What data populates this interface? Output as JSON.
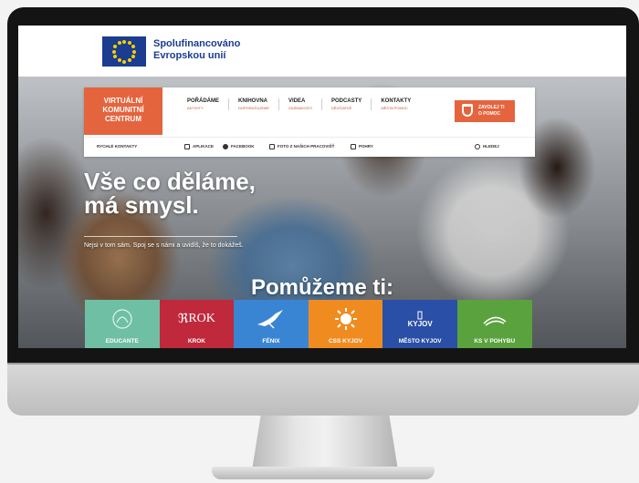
{
  "eu_banner": {
    "line1": "Spolufinancováno",
    "line2": "Evropskou unií",
    "flag_color": "#1b3c8f",
    "star_color": "#f5d000"
  },
  "nav": {
    "brand_line1": "VIRTUÁLNÍ",
    "brand_line2": "KOMUNITNÍ",
    "brand_line3": "CENTRUM",
    "brand_color": "#e4643e",
    "menu": [
      {
        "label": "POŘÁDÁME",
        "sub": "AKTIVITY"
      },
      {
        "label": "KNIHOVNA",
        "sub": "DOPORUČUJEME"
      },
      {
        "label": "VIDEA",
        "sub": "ZAJÍMAVOSTI"
      },
      {
        "label": "PODCASTY",
        "sub": "DĚVČIATKÉ"
      },
      {
        "label": "KONTAKTY",
        "sub": "MĚSTA POMOC"
      }
    ],
    "help_button_line1": "ZAVOLEJ TI",
    "help_button_line2": "O POMOC"
  },
  "subnav": {
    "quick_contact": "RYCHLÉ KONTAKTY",
    "apps": "APLIKACE",
    "facebook": "FACEBOOK",
    "photos": "FOTO Z NAŠICH PRACOVIŠŤ",
    "games": "POHRY",
    "search": "HLEDEJ"
  },
  "hero": {
    "headline_line1": "Vše co děláme,",
    "headline_line2": "má smysl.",
    "tagline": "Nejsi v tom sám. Spoj se s námi a uvidíš, že to dokážeš.",
    "helps_title": "Pomůžeme ti:"
  },
  "tiles": [
    {
      "label": "EDUCANTE",
      "color": "#6fbfa5",
      "icon": "educante-logo-icon"
    },
    {
      "label": "KROK",
      "color": "#c0283c",
      "icon": "krok-logo-icon",
      "logo_text": "ROK"
    },
    {
      "label": "FÉNIX",
      "color": "#3a85d3",
      "icon": "fenix-bird-icon"
    },
    {
      "label": "CSS KYJOV",
      "color": "#f08c1f",
      "icon": "sun-icon"
    },
    {
      "label": "MĚSTO KYJOV",
      "color": "#2a4fa6",
      "icon": "kyjov-logo-icon",
      "logo_text": "KYJOV"
    },
    {
      "label": "KS V POHYBU",
      "color": "#5aa23d",
      "icon": "ks-logo-icon"
    }
  ]
}
